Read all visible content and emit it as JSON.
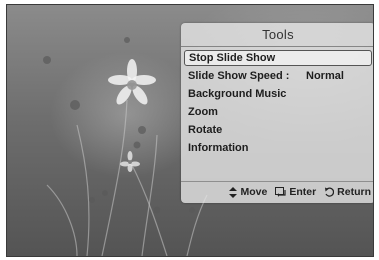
{
  "panel": {
    "title": "Tools",
    "items": [
      {
        "label": "Stop Slide Show",
        "value": "",
        "selected": true
      },
      {
        "label": "Slide Show Speed :",
        "value": "Normal",
        "selected": false
      },
      {
        "label": "Background Music",
        "value": "",
        "selected": false
      },
      {
        "label": "Zoom",
        "value": "",
        "selected": false
      },
      {
        "label": "Rotate",
        "value": "",
        "selected": false
      },
      {
        "label": "Information",
        "value": "",
        "selected": false
      }
    ]
  },
  "footer": {
    "move": {
      "label": "Move",
      "icon": "up-down-arrows-icon"
    },
    "enter": {
      "label": "Enter",
      "icon": "enter-icon"
    },
    "return": {
      "label": "Return",
      "icon": "return-icon"
    }
  }
}
